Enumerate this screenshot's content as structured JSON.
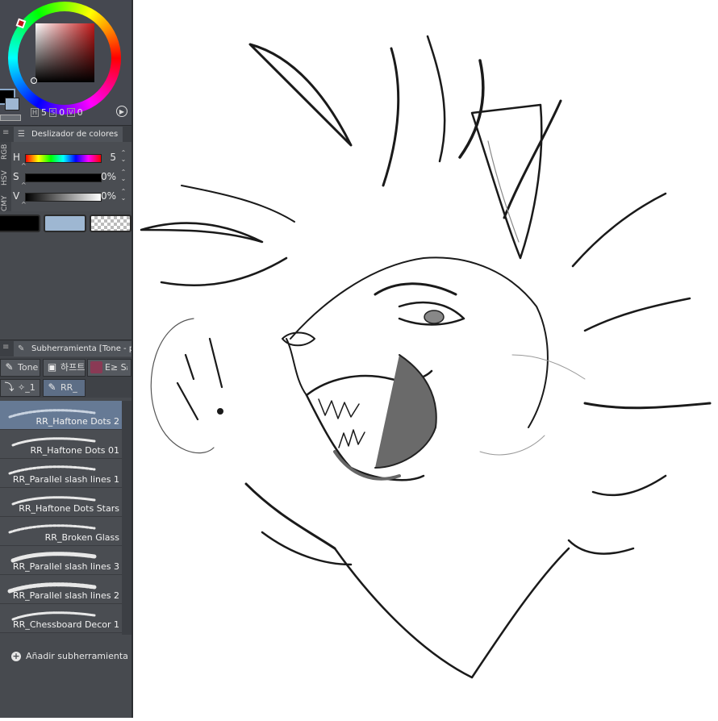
{
  "color_wheel": {
    "readout": [
      {
        "label": "H",
        "value": "5"
      },
      {
        "label": "S",
        "value": "0"
      },
      {
        "label": "V",
        "value": "0"
      }
    ],
    "main_color": "#000000",
    "sub_color": "#9eb7d2",
    "hue_color": "#c21818"
  },
  "color_slider": {
    "tab_label": "Deslizador de colores",
    "modes": [
      "RGB",
      "HSV",
      "CMY"
    ],
    "rows": [
      {
        "channel": "H",
        "value": "5"
      },
      {
        "channel": "S",
        "value": "0%"
      },
      {
        "channel": "V",
        "value": "0%"
      }
    ],
    "swatches": {
      "main": "#000000",
      "sub": "#9eb7d2",
      "transparent": "transparent"
    }
  },
  "subtool": {
    "tab_label": "Subherramienta [Tone - pre",
    "group_tabs": [
      {
        "label": "Tone",
        "icon": "pen-icon"
      },
      {
        "label": "하프트",
        "icon": "camera-icon"
      },
      {
        "label": "Ε≥ Sᵢ",
        "icon": "avatar-icon"
      },
      {
        "label": "✧_1",
        "icon": "brush-icon"
      },
      {
        "label": "RR_",
        "icon": "pen-icon"
      }
    ],
    "brushes": [
      {
        "label": "RR_Haftone Dots 2"
      },
      {
        "label": "RR_Haftone Dots 01"
      },
      {
        "label": "RR_Parallel slash lines 1"
      },
      {
        "label": "RR_Haftone Dots Stars"
      },
      {
        "label": "RR_Broken Glass"
      },
      {
        "label": "RR_Parallel slash lines 3"
      },
      {
        "label": "RR_Parallel slash lines 2"
      },
      {
        "label": "RR_Chessboard Decor 1"
      }
    ],
    "add_label": "Añadir subherramienta"
  }
}
